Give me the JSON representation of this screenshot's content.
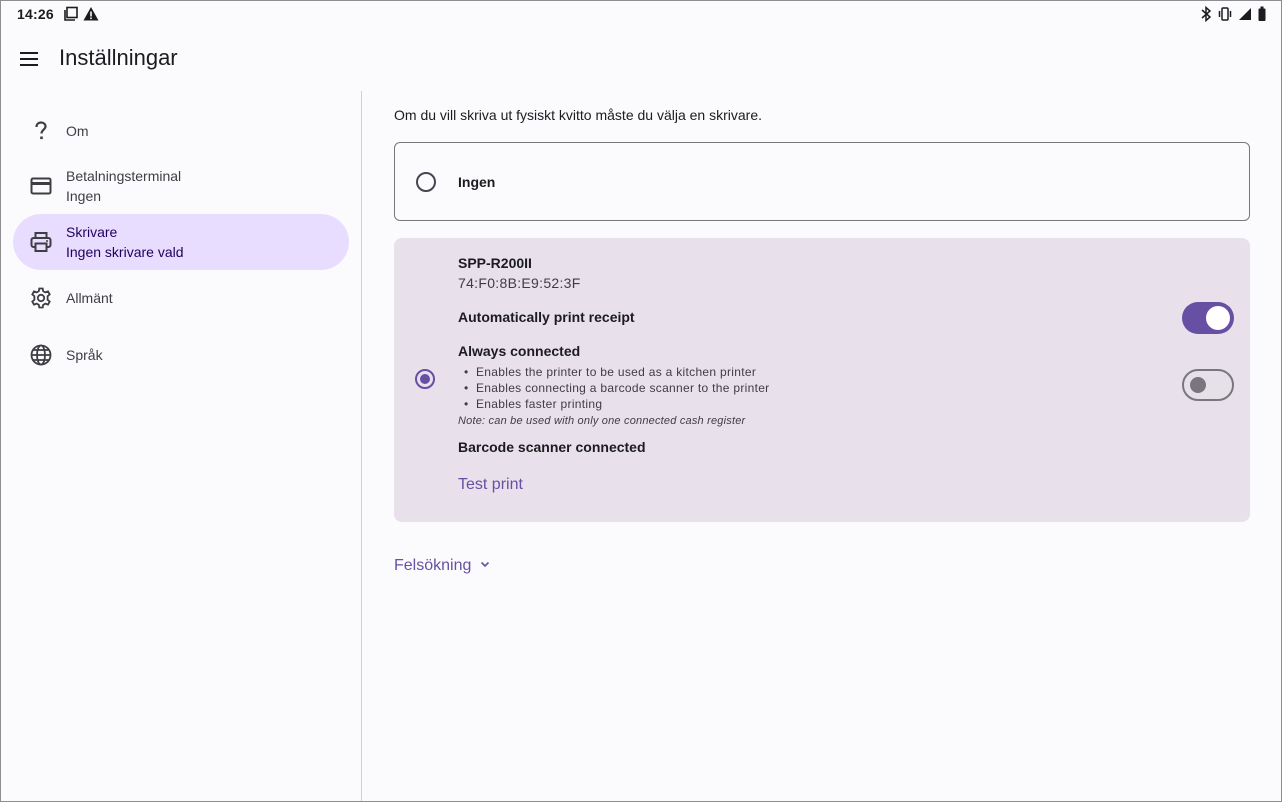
{
  "status_bar": {
    "time": "14:26",
    "left_icons": [
      "screenshot-icon",
      "alert-icon"
    ],
    "right_icons": [
      "bluetooth-icon",
      "vibrate-icon",
      "signal-icon",
      "battery-icon"
    ]
  },
  "app_bar": {
    "title": "Inställningar",
    "menu_icon": "menu-icon"
  },
  "sidebar": {
    "items": [
      {
        "icon": "help-icon",
        "label": "Om",
        "sublabel": ""
      },
      {
        "icon": "credit-card-icon",
        "label": "Betalningsterminal",
        "sublabel": "Ingen"
      },
      {
        "icon": "printer-icon",
        "label": "Skrivare",
        "sublabel": "Ingen skrivare vald",
        "active": true
      },
      {
        "icon": "gear-icon",
        "label": "Allmänt",
        "sublabel": ""
      },
      {
        "icon": "globe-icon",
        "label": "Språk",
        "sublabel": ""
      }
    ]
  },
  "main": {
    "intro": "Om du vill skriva ut fysiskt kvitto måste du välja en skrivare.",
    "option_none": {
      "label": "Ingen",
      "selected": false
    },
    "printer": {
      "selected": true,
      "name": "SPP-R200II",
      "mac": "74:F0:8B:E9:52:3F",
      "auto_print_label": "Automatically print receipt",
      "auto_print_enabled": true,
      "always_connected_label": "Always connected",
      "always_connected_enabled": false,
      "bullets": [
        "Enables the printer to be used as a kitchen printer",
        "Enables connecting a barcode scanner to the printer",
        "Enables faster printing"
      ],
      "note": "Note: can be used with only one connected cash register",
      "barcode_label": "Barcode scanner connected",
      "test_print_label": "Test print"
    },
    "troubleshooting_label": "Felsökning"
  },
  "colors": {
    "accent": "#6750a4",
    "active_nav_bg": "#e9ddff",
    "printer_card_bg": "#e8e0eb",
    "background": "#fbfbfe"
  }
}
